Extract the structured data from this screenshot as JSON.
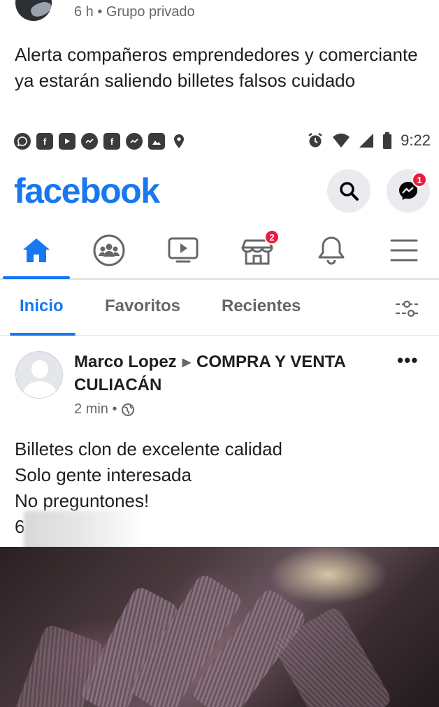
{
  "outer_post": {
    "meta": "6 h • Grupo privado",
    "text": "Alerta compañeros emprendedores y comerciante ya estarán saliendo billetes falsos cuidado"
  },
  "status_bar": {
    "time": "9:22",
    "left_icons": [
      "whatsapp-icon",
      "facebook-icon",
      "youtube-icon",
      "messenger-icon",
      "facebook-icon",
      "messenger-icon",
      "gallery-icon",
      "location-icon"
    ],
    "right_icons": [
      "alarm-icon",
      "wifi-icon",
      "signal-icon",
      "battery-icon"
    ]
  },
  "header": {
    "logo": "facebook",
    "messenger_badge": "1"
  },
  "nav": {
    "items": [
      {
        "name": "home",
        "badge": ""
      },
      {
        "name": "groups",
        "badge": ""
      },
      {
        "name": "watch",
        "badge": ""
      },
      {
        "name": "marketplace",
        "badge": "2"
      },
      {
        "name": "notifications",
        "badge": ""
      },
      {
        "name": "menu",
        "badge": ""
      }
    ]
  },
  "feed_tabs": {
    "inicio": "Inicio",
    "favoritos": "Favoritos",
    "recientes": "Recientes"
  },
  "post": {
    "author": "Marco Lopez",
    "group": "COMPRA Y VENTA CULIACÁN",
    "time": "2 min •",
    "lines": [
      "Billetes clon de excelente calidad",
      "Solo gente interesada",
      "No preguntones!",
      "6"
    ]
  }
}
